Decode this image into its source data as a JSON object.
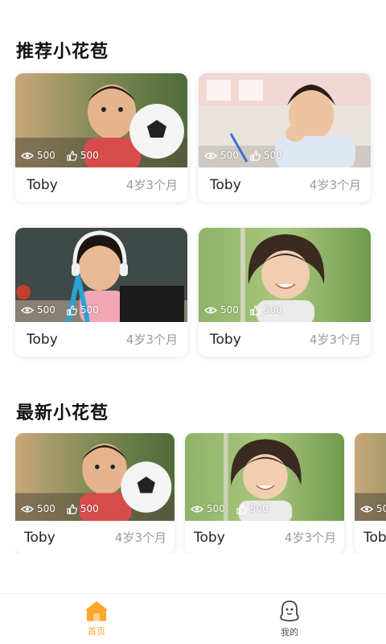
{
  "sections": {
    "recommended_title": "推荐小花苞",
    "latest_title": "最新小花苞"
  },
  "recommended": [
    {
      "name": "Toby",
      "age": "4岁3个月",
      "views": "500",
      "likes": "500"
    },
    {
      "name": "Toby",
      "age": "4岁3个月",
      "views": "500",
      "likes": "500"
    },
    {
      "name": "Toby",
      "age": "4岁3个月",
      "views": "500",
      "likes": "500"
    },
    {
      "name": "Toby",
      "age": "4岁3个月",
      "views": "500",
      "likes": "500"
    }
  ],
  "latest": [
    {
      "name": "Toby",
      "age": "4岁3个月",
      "views": "500",
      "likes": "500"
    },
    {
      "name": "Toby",
      "age": "4岁3个月",
      "views": "500",
      "likes": "500"
    },
    {
      "name": "Tob",
      "age": "",
      "views": "50",
      "likes": ""
    }
  ],
  "tabbar": {
    "home_label": "首页",
    "mine_label": "我的",
    "active_color": "#ffa52a"
  },
  "icons": {
    "views": "eye-icon",
    "likes": "thumbs-up-icon",
    "home": "home-icon",
    "mine": "ghost-user-icon"
  }
}
